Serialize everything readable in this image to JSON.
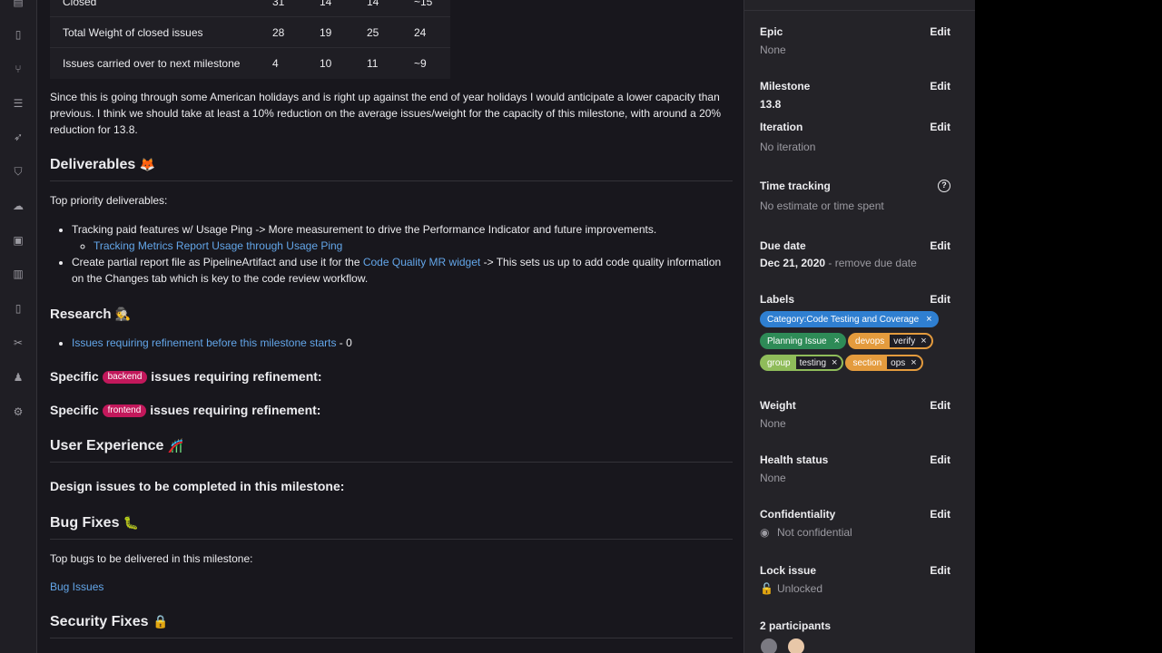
{
  "table": {
    "rows": [
      {
        "label": "Closed",
        "values": [
          "31",
          "14",
          "14",
          "~15"
        ]
      },
      {
        "label": "Total Weight of closed issues",
        "values": [
          "28",
          "19",
          "25",
          "24"
        ]
      },
      {
        "label": "Issues carried over to next milestone",
        "values": [
          "4",
          "10",
          "11",
          "~9"
        ]
      }
    ]
  },
  "capacity_paragraph": "Since this is going through some American holidays and is right up against the end of year holidays I would anticipate a lower capacity than previous. I think we should take at least a 10% reduction on the average issues/weight for the capacity of this milestone, with around a 20% reduction for 13.8.",
  "deliverables": {
    "heading": "Deliverables",
    "emoji": "🦊",
    "intro": "Top priority deliverables:",
    "item1": "Tracking paid features w/ Usage Ping -> More measurement to drive the Performance Indicator and future improvements.",
    "item1_sub_link": "Tracking Metrics Report Usage through Usage Ping",
    "item2_prefix": "Create partial report file as PipelineArtifact and use it for the ",
    "item2_link": "Code Quality MR widget",
    "item2_suffix": " -> This sets us up to add code quality information on the Changes tab which is key to the code review workflow."
  },
  "research": {
    "heading": "Research",
    "emoji": "🕵",
    "link": "Issues requiring refinement before this milestone starts",
    "suffix": " - 0"
  },
  "specific_backend": {
    "prefix": "Specific",
    "pill": "backend",
    "suffix": "issues requiring refinement:"
  },
  "specific_frontend": {
    "prefix": "Specific",
    "pill": "frontend",
    "suffix": "issues requiring refinement:"
  },
  "ux": {
    "heading": "User Experience",
    "emoji": "🎢",
    "subheading": "Design issues to be completed in this milestone:"
  },
  "bugs": {
    "heading": "Bug Fixes",
    "emoji": "🐛",
    "intro": "Top bugs to be delivered in this milestone:",
    "link": "Bug Issues"
  },
  "security": {
    "heading": "Security Fixes",
    "emoji": "🔒"
  },
  "sidebar": {
    "edit": "Edit",
    "epic": {
      "title": "Epic",
      "value": "None"
    },
    "milestone": {
      "title": "Milestone",
      "value": "13.8"
    },
    "iteration": {
      "title": "Iteration",
      "value": "No iteration"
    },
    "time_tracking": {
      "title": "Time tracking",
      "value": "No estimate or time spent"
    },
    "due_date": {
      "title": "Due date",
      "value": "Dec 21, 2020",
      "remove": " - remove due date"
    },
    "labels": {
      "title": "Labels",
      "items": [
        {
          "key": "Category:Code Testing and Coverage",
          "value": "",
          "color": "#2f7fd1"
        },
        {
          "key": "Planning Issue",
          "value": "",
          "color": "#2e8b57"
        },
        {
          "key": "devops",
          "value": "verify",
          "color": "#e49b3d"
        },
        {
          "key": "group",
          "value": "testing",
          "color": "#8fbc5a"
        },
        {
          "key": "section",
          "value": "ops",
          "color": "#e49b3d"
        }
      ]
    },
    "weight": {
      "title": "Weight",
      "value": "None"
    },
    "health": {
      "title": "Health status",
      "value": "None"
    },
    "confidentiality": {
      "title": "Confidentiality",
      "value": "Not confidential"
    },
    "lock": {
      "title": "Lock issue",
      "value": "Unlocked"
    },
    "participants": {
      "title": "2 participants"
    }
  }
}
